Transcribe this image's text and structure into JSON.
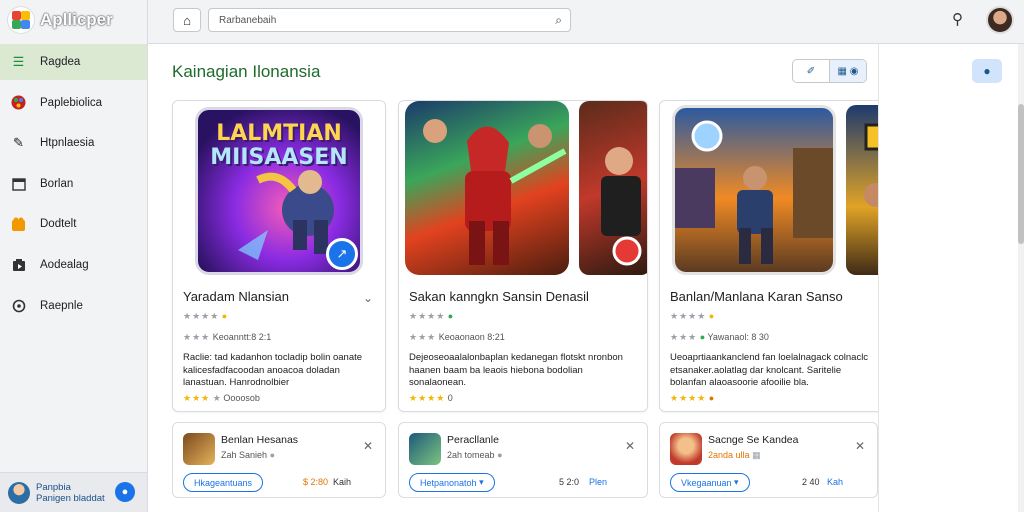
{
  "app": {
    "name": "Apllicper"
  },
  "sidebar": {
    "items": [
      {
        "label": "Ragdea",
        "icon": "menu-icon"
      },
      {
        "label": "Paplebiolica",
        "icon": "palette-icon"
      },
      {
        "label": "Htpnlaesia",
        "icon": "pen-icon"
      },
      {
        "label": "Borlan",
        "icon": "calendar-icon"
      },
      {
        "label": "Dodtelt",
        "icon": "puzzle-icon"
      },
      {
        "label": "Aodealag",
        "icon": "media-icon"
      },
      {
        "label": "Raepnle",
        "icon": "settings-icon"
      }
    ],
    "footer_line1": "Panpbia",
    "footer_line2": "Panigen bladdat"
  },
  "topbar": {
    "search_value": "Rarbanebaih"
  },
  "main": {
    "title": "Kainagian Ilonansia",
    "feature_cards": [
      {
        "title": "Yaradam Nlansian",
        "rating_text": "Keoanntt:8 2:1",
        "desc": "Raclie: tad kadanhon tocladip bolin oanate kalicesfadfacoodan anoacoa doladan lanastuan. Hanrodnolbier",
        "footer": "Oooosob",
        "art_title_line1": "LALMTIAN",
        "art_title_line2": "MIISAASEN"
      },
      {
        "title": "Sakan kanngkn Sansin Denasil",
        "rating_text": "Keoaonaon 8:21",
        "desc": "Dejeoseoaalalonbaplan kedanegan flotskt nronbon haanen baam ba leaois hiebona bodolian sonalaonean.",
        "footer": "0"
      },
      {
        "title": "Banlan/Manlana Karan Sanso",
        "rating_text": "Yawanaol: 8 30",
        "desc": "Ueoaprtiaankanclend fan loelalnagack colnaclc etsanaker.aolatlag dar knolcant. Saritelie bolanfan alaoasoorie afooilie bla.",
        "footer": ""
      }
    ],
    "small_cards": [
      {
        "title": "Benlan Hesanas",
        "sub": "Zah Sanieh",
        "button": "Hkageantuans",
        "price": "$ 2:80",
        "meta": "Kaih"
      },
      {
        "title": "Peracllanle",
        "sub": "2ah tomeab",
        "button": "Hetpanonatoh",
        "price": "5 2:0",
        "meta": "Plen"
      },
      {
        "title": "Sacnge Se Kandea",
        "sub": "2anda ulla",
        "button": "Vkegaanuan",
        "price": "2 40",
        "meta": "Kah"
      }
    ]
  },
  "colors": {
    "accent": "#1a73e8",
    "title_green": "#1e6b2c",
    "active_nav": "#dbe9d3",
    "star": "#f4b400"
  }
}
